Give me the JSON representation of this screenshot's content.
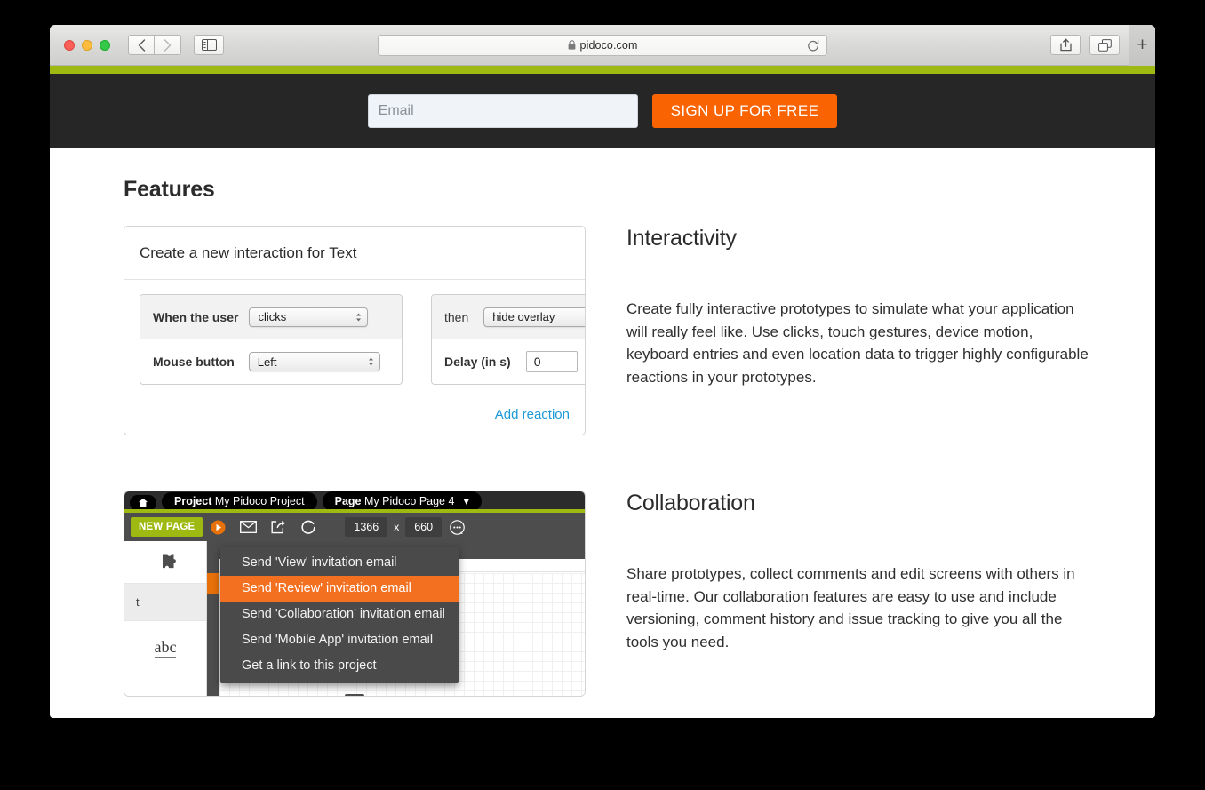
{
  "browser": {
    "address": "pidoco.com",
    "lock_icon": "lock-icon",
    "reload_icon": "reload-icon",
    "back_icon": "chevron-left-icon",
    "forward_icon": "chevron-right-icon",
    "sidebar_icon": "sidebar-toggle-icon",
    "share_icon": "share-icon",
    "tabs_icon": "show-tabs-icon",
    "newtab_label": "+",
    "accent_green": "#9fb913"
  },
  "signup": {
    "email_placeholder": "Email",
    "email_value": "",
    "button_label": "SIGN UP FOR FREE",
    "button_color": "#f96302"
  },
  "page": {
    "section_title": "Features"
  },
  "features": [
    {
      "heading": "Interactivity",
      "paragraph": "Create fully interactive prototypes to simulate what your application will really feel like. Use clicks, touch gestures, device motion, keyboard entries and even location data to trigger highly configurable reactions in your prototypes."
    },
    {
      "heading": "Collaboration",
      "paragraph": "Share prototypes, collect comments and edit screens with others in real-time. Our collaboration features are easy to use and include versioning, comment history and issue tracking to give you all the tools you need."
    }
  ],
  "interaction_dialog": {
    "title": "Create a new interaction for Text",
    "when_label": "When the user",
    "when_value": "clicks",
    "mouse_label": "Mouse button",
    "mouse_value": "Left",
    "then_label": "then",
    "then_value": "hide overlay",
    "delay_label": "Delay (in s)",
    "delay_value": "0",
    "add_reaction_label": "Add reaction",
    "link_color": "#1b9ad6"
  },
  "editor": {
    "home_icon": "home-icon",
    "project_prefix": "Project",
    "project_name": "My Pidoco Project",
    "page_prefix": "Page",
    "page_name": "My Pidoco Page 4  |  ▾",
    "new_page_label": "NEW PAGE",
    "play_icon": "play-icon",
    "mail_icon": "envelope-icon",
    "share_icon": "share-arrow-icon",
    "refresh_icon": "refresh-icon",
    "width_value": "1366",
    "dim_separator": "x",
    "height_value": "660",
    "more_icon": "more-options-icon",
    "puzzle_icon": "puzzle-piece-icon",
    "tool_row_label": "t",
    "text_tool_label": "abc",
    "lines_icon": "stack-lines-icon",
    "menu_items": [
      {
        "label": "Send 'View' invitation email",
        "active": false
      },
      {
        "label": "Send 'Review' invitation email",
        "active": true
      },
      {
        "label": "Send 'Collaboration' invitation email",
        "active": false
      },
      {
        "label": "Send 'Mobile App' invitation email",
        "active": false
      },
      {
        "label": "Get a link to this project",
        "active": false
      }
    ],
    "highlight_color": "#f37021"
  }
}
